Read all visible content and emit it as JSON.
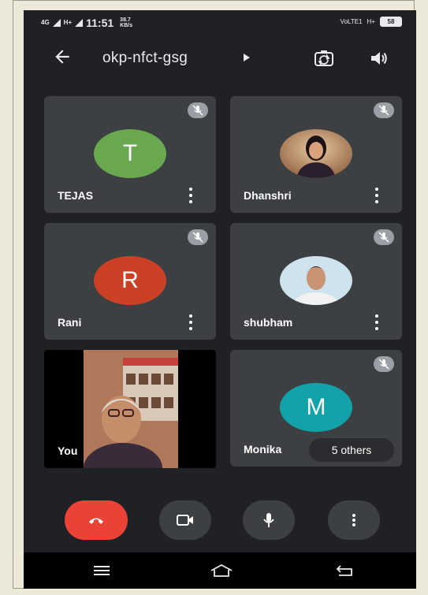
{
  "status_bar": {
    "network_1": "4G",
    "network_2": "H+",
    "time": "11:51",
    "speed_value": "38.7",
    "speed_unit": "KB/s",
    "volte": "VoLTE1",
    "network_3": "H+",
    "battery": "58"
  },
  "header": {
    "meeting_code": "okp-nfct-gsg",
    "back_icon": "arrow-left-icon",
    "switch_camera_icon": "camera-switch-icon",
    "speaker_icon": "speaker-icon"
  },
  "participants": [
    {
      "name": "TEJAS",
      "initial": "T",
      "color": "#6aa84f",
      "muted": true
    },
    {
      "name": "Dhanshri",
      "muted": true
    },
    {
      "name": "Rani",
      "initial": "R",
      "color": "#cc4125",
      "muted": true
    },
    {
      "name": "shubham",
      "muted": true
    },
    {
      "name": "You",
      "muted": false
    },
    {
      "name": "Monika",
      "initial": "M",
      "color": "#12a3aa",
      "muted": true
    }
  ],
  "others_label": "5 others",
  "colors": {
    "background": "#202124",
    "tile": "#3c4043",
    "hangup": "#ea4335"
  }
}
